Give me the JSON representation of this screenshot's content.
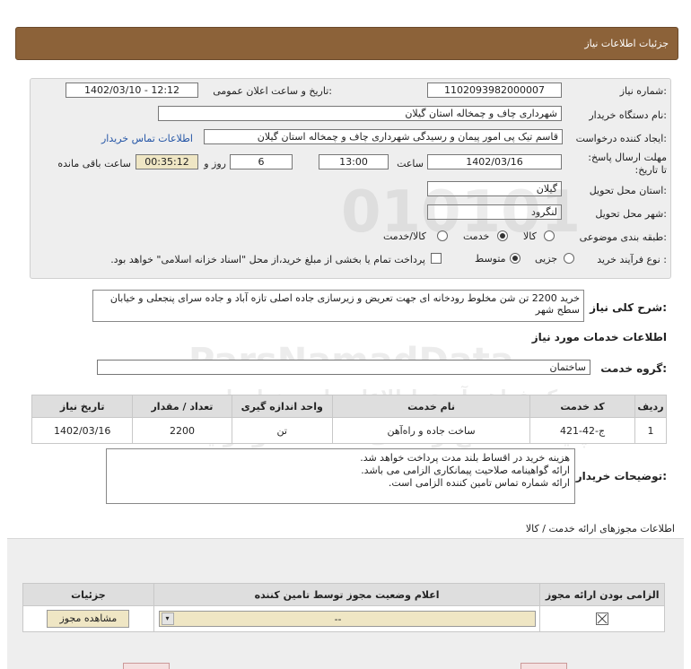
{
  "header": {
    "title": "جزئیات اطلاعات نیاز"
  },
  "form": {
    "need_number": {
      "label": "شماره نیاز:",
      "value": "1102093982000007"
    },
    "announce_datetime": {
      "label": "تاریخ و ساعت اعلان عمومی:",
      "value": "1402/03/10 - 12:12"
    },
    "buyer_org": {
      "label": "نام دستگاه خریدار:",
      "value": "شهرداری چاف و چمخاله استان گیلان"
    },
    "requester": {
      "label": "ایجاد کننده درخواست:",
      "value": "قاسم تیک پی امور پیمان و رسیدگی شهرداری چاف و چمخاله استان گیلان"
    },
    "buyer_contact_link": "اطلاعات تماس خریدار",
    "deadline": {
      "label": "مهلت ارسال پاسخ: تا تاریخ:",
      "date": "1402/03/16",
      "time_label": "ساعت",
      "time": "13:00",
      "days": "6",
      "days_label": "روز و",
      "remaining": "00:35:12",
      "remaining_label": "ساعت باقی مانده"
    },
    "province": {
      "label": "استان محل تحویل:",
      "value": "گیلان"
    },
    "city": {
      "label": "شهر محل تحویل:",
      "value": "لنگرود"
    },
    "category": {
      "label": "طبقه بندی موضوعی:",
      "options": [
        "کالا",
        "خدمت",
        "کالا/خدمت"
      ],
      "selected": "خدمت"
    },
    "purchase_type": {
      "label": "نوع فرآیند خرید :",
      "options": [
        "جزیی",
        "متوسط"
      ],
      "selected": "متوسط",
      "checkbox_label": "پرداخت تمام یا بخشی از مبلغ خرید،از محل \"اسناد خزانه اسلامی\" خواهد بود."
    }
  },
  "description": {
    "label": "شرح کلی نیاز:",
    "text": "خرید 2200 تن شن مخلوط  رودخانه ای جهت تعریض و زیرسازی جاده اصلی تازه آباد و جاده سرای پنجعلی و خیابان سطح شهر"
  },
  "services_heading": "اطلاعات خدمات مورد نیاز",
  "service_group": {
    "label": "گروه خدمت:",
    "value": "ساختمان"
  },
  "table": {
    "headers": [
      "ردیف",
      "کد خدمت",
      "نام خدمت",
      "واحد اندازه گیری",
      "تعداد / مقدار",
      "تاریخ نیاز"
    ],
    "rows": [
      [
        "1",
        "ج-42-421",
        "ساخت جاده و راه‌آهن",
        "تن",
        "2200",
        "1402/03/16"
      ]
    ]
  },
  "buyer_notes": {
    "label": "توضیحات خریدار:",
    "lines": [
      "هزینه خرید در اقساط بلند مدت پرداخت خواهد شد.",
      "ارائه گواهینامه صلاحیت پیمانکاری الزامی می باشد.",
      "ارائه شماره تماس تامین کننده الزامی است."
    ]
  },
  "permits": {
    "heading": "اطلاعات مجوزهای ارائه خدمت / کالا",
    "headers": [
      "الزامی بودن ارائه مجوز",
      "اعلام وضعیت مجوز توسط تامین کننده",
      "جزئیات"
    ],
    "row": {
      "status_value": "--",
      "view_button": "مشاهده مجوز"
    }
  },
  "watermark": {
    "brand": "ParsNamadData",
    "line1": "مرکز فراهم آوری اطلاعات پارس نماد داده",
    "line2": "پایگاه اطلاع رسانی مناقصه ومزایده",
    "phone": "۰۲۱-۸۸۳۴۹۶۷۰"
  }
}
